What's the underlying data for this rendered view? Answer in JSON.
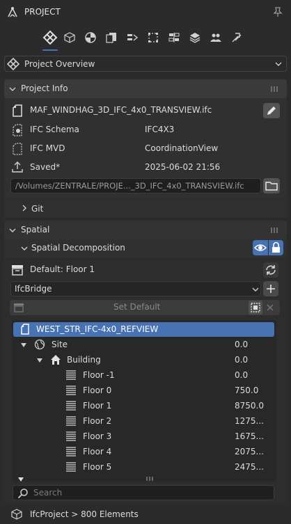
{
  "header": {
    "title": "PROJECT"
  },
  "tabs": [
    {
      "icon": "ifc-logo-icon",
      "active": true
    },
    {
      "icon": "cube-icon"
    },
    {
      "icon": "material-icon"
    },
    {
      "icon": "sheets-icon"
    },
    {
      "icon": "schedule-icon"
    },
    {
      "icon": "structural-icon"
    },
    {
      "icon": "services-icon"
    },
    {
      "icon": "quality-icon"
    },
    {
      "icon": "people-icon"
    },
    {
      "icon": "fm-icon"
    }
  ],
  "overview_dropdown": {
    "label": "Project Overview"
  },
  "project_info": {
    "section_title": "Project Info",
    "file_name": "MAF_WINDHAG_3D_IFC_4x0_TRANSVIEW.ifc",
    "rows": [
      {
        "label": "IFC Schema",
        "value": "IFC4X3"
      },
      {
        "label": "IFC MVD",
        "value": "CoordinationView"
      },
      {
        "label": "Saved*",
        "value": "2025-06-02 21:56"
      }
    ],
    "path": "/Volumes/ZENTRALE/PROJE..._3D_IFC_4x0_TRANSVIEW.ifc"
  },
  "git": {
    "label": "Git"
  },
  "spatial": {
    "section_title": "Spatial",
    "decomposition_label": "Spatial Decomposition",
    "default_label": "Default: Floor 1",
    "class_select": "IfcBridge",
    "set_default_label": "Set Default",
    "tree": [
      {
        "name": "WEST_STR_IFC-4x0_REFVIEW",
        "value": "",
        "selected": true
      },
      {
        "name": "Site",
        "value": "0.0"
      },
      {
        "name": "Building",
        "value": "0.0"
      },
      {
        "name": "Floor -1",
        "value": "0.0"
      },
      {
        "name": "Floor 0",
        "value": "750.0"
      },
      {
        "name": "Floor 1",
        "value": "8750.0"
      },
      {
        "name": "Floor 2",
        "value": "1275..."
      },
      {
        "name": "Floor 3",
        "value": "1675..."
      },
      {
        "name": "Floor 4",
        "value": "2075..."
      },
      {
        "name": "Floor 5",
        "value": "2475..."
      }
    ],
    "search_placeholder": "Search",
    "footer": "IfcProject > 800 Elements"
  },
  "colors": {
    "accent": "#4772b3",
    "selected_row": "#4772b3",
    "background": "#2b2b2b"
  }
}
